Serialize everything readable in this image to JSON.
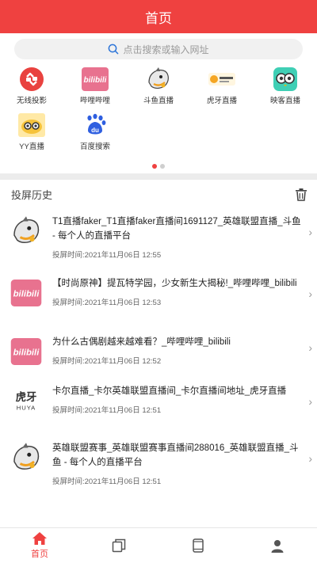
{
  "header": {
    "title": "首页"
  },
  "search": {
    "placeholder": "点击搜索或输入网址"
  },
  "apps": [
    {
      "label": "无线投影",
      "icon": "cast-icon"
    },
    {
      "label": "哔哩哔哩",
      "icon": "bilibili-icon"
    },
    {
      "label": "斗鱼直播",
      "icon": "douyu-icon"
    },
    {
      "label": "虎牙直播",
      "icon": "huya-icon"
    },
    {
      "label": "映客直播",
      "icon": "inke-icon"
    },
    {
      "label": "YY直播",
      "icon": "yy-icon"
    },
    {
      "label": "百度搜索",
      "icon": "baidu-icon"
    }
  ],
  "pager": {
    "pages": 2,
    "active": 1
  },
  "history": {
    "title": "投屏历史",
    "items": [
      {
        "title": "T1直播faker_T1直播faker直播间1691127_英雄联盟直播_斗鱼 - 每个人的直播平台",
        "time": "投屏时间:2021年11月06日 12:55",
        "icon": "douyu-icon"
      },
      {
        "title": "【时尚原神】提瓦特学园，少女新生大揭秘!_哔哩哔哩_bilibili",
        "time": "投屏时间:2021年11月06日 12:53",
        "icon": "bilibili-icon"
      },
      {
        "title": "为什么古偶剧越来越难看？_哔哩哔哩_bilibili",
        "time": "投屏时间:2021年11月06日 12:52",
        "icon": "bilibili-icon"
      },
      {
        "title": "卡尔直播_卡尔英雄联盟直播间_卡尔直播间地址_虎牙直播",
        "time": "投屏时间:2021年11月06日 12:51",
        "icon": "huya-icon"
      },
      {
        "title": "英雄联盟赛事_英雄联盟赛事直播间288016_英雄联盟直播_斗鱼 - 每个人的直播平台",
        "time": "投屏时间:2021年11月06日 12:51",
        "icon": "douyu-icon"
      }
    ]
  },
  "tabbar": {
    "home_label": "首页"
  },
  "colors": {
    "accent": "#ef4140",
    "bilibili": "#e8728f"
  }
}
